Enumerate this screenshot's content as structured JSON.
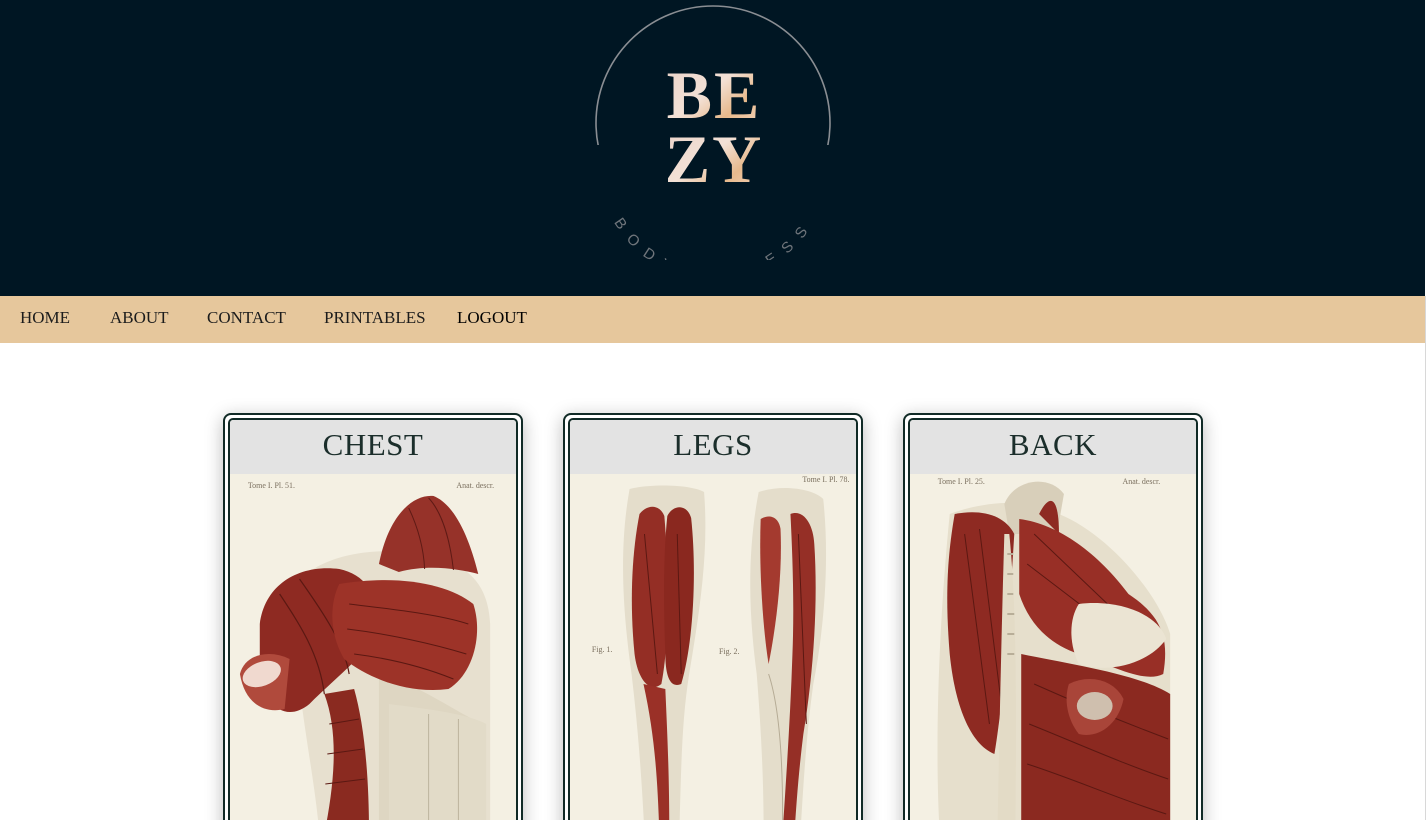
{
  "brand": {
    "line1": "BE",
    "line2": "ZY",
    "tagline": "BODY FITNESS"
  },
  "nav": {
    "items": [
      {
        "label": "HOME"
      },
      {
        "label": "ABOUT"
      },
      {
        "label": "CONTACT"
      },
      {
        "label": "PRINTABLES"
      },
      {
        "label": "LOGOUT"
      }
    ]
  },
  "cards": [
    {
      "title": "CHEST",
      "plate_left": "Tome I. Pl. 51.",
      "plate_right": "Anat. descr."
    },
    {
      "title": "LEGS",
      "plate_left": "Fig. 1.",
      "plate_right": "Tome I. Pl. 78.",
      "plate_mid": "Fig. 2."
    },
    {
      "title": "BACK",
      "plate_left": "Tome I. Pl. 25.",
      "plate_right": "Anat. descr."
    }
  ],
  "colors": {
    "header_bg": "#001623",
    "nav_bg": "#e6c79c",
    "card_border": "#102a26",
    "muscle": "#8e2a22"
  }
}
